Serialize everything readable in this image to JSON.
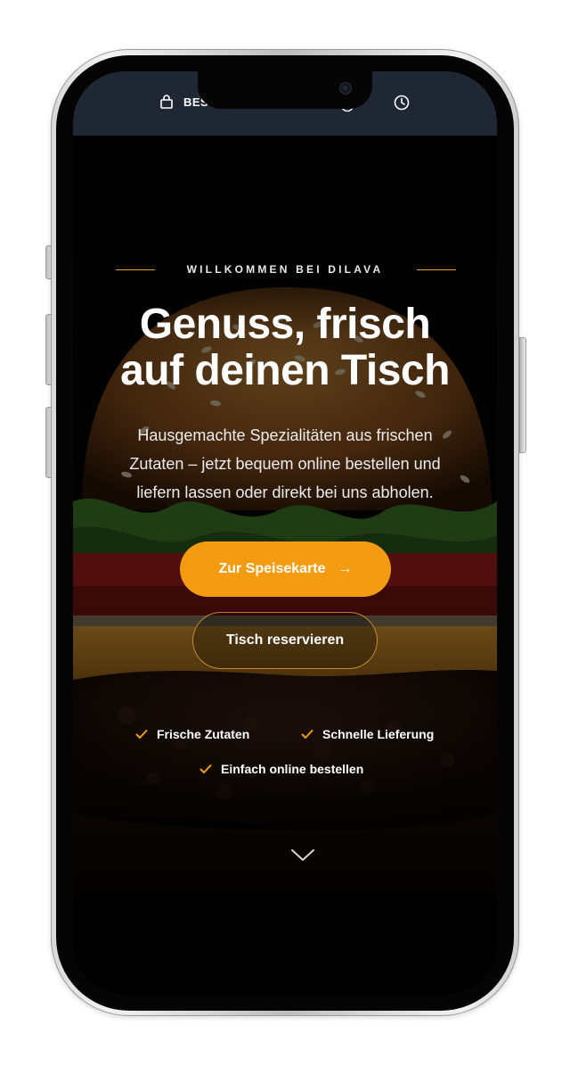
{
  "topbar": {
    "label": "BES"
  },
  "hero": {
    "eyebrow": "WILLKOMMEN BEI DILAVA",
    "headline_line1": "Genuss, frisch",
    "headline_line2": "auf deinen Tisch",
    "subtext_line1": "Hausgemachte Spezialitäten aus frischen",
    "subtext_line2": "Zutaten – jetzt bequem online bestellen und",
    "subtext_line3": "liefern lassen oder direkt bei uns abholen.",
    "primary_cta": "Zur Speisekarte",
    "primary_cta_icon": "→",
    "secondary_cta": "Tisch reservieren",
    "features": [
      {
        "label": "Frische Zutaten",
        "icon": "check-icon"
      },
      {
        "label": "Schnelle Lieferung",
        "icon": "check-icon"
      },
      {
        "label": "Einfach online bestellen",
        "icon": "check-icon"
      }
    ]
  },
  "colors": {
    "accent": "#f39c11",
    "topbar": "#1e2733",
    "background": "#000000"
  }
}
